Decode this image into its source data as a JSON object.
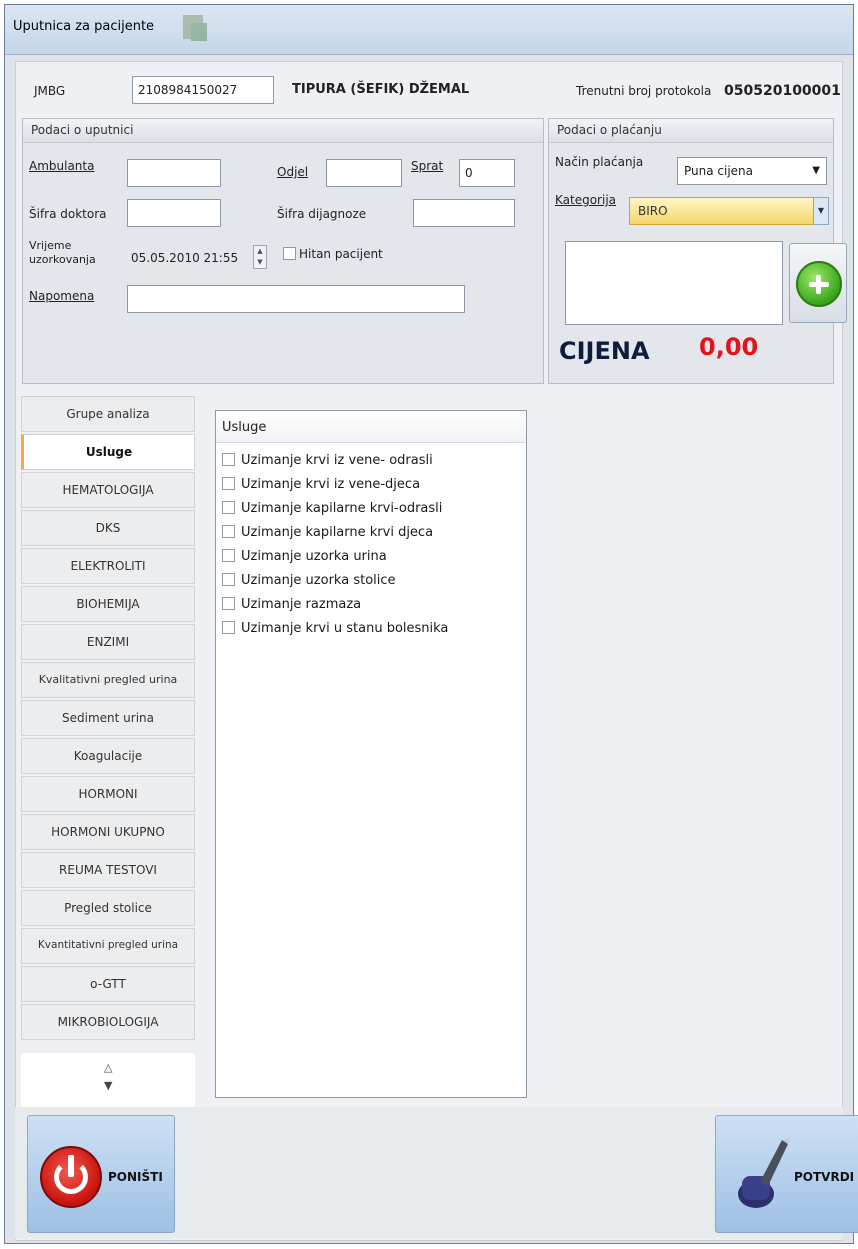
{
  "window": {
    "title": "Uputnica za pacijente"
  },
  "patient": {
    "jmbg_label": "JMBG",
    "jmbg_value": "2108984150027",
    "name": "TIPURA (ŠEFIK) DŽEMAL",
    "protocol_label": "Trenutni broj protokola",
    "protocol_value": "050520100001"
  },
  "referral": {
    "group_title": "Podaci o uputnici",
    "ambulanta_label": "Ambulanta",
    "ambulanta_value": "",
    "odjel_label": "Odjel",
    "odjel_value": "",
    "sprat_label": "Sprat",
    "sprat_value": "0",
    "sifra_doktora_label": "Šifra doktora",
    "sifra_doktora_value": "",
    "sifra_dijagnoze_label": "Šifra dijagnoze",
    "sifra_dijagnoze_value": "",
    "vrijeme_label_1": "Vrijeme",
    "vrijeme_label_2": "uzorkovanja",
    "vrijeme_value": "05.05.2010 21:55",
    "hitan_label": "Hitan pacijent",
    "napomena_label": "Napomena",
    "napomena_value": ""
  },
  "payment": {
    "group_title": "Podaci o plaćanju",
    "nacin_label": "Način plaćanja",
    "nacin_value": "Puna cijena",
    "kategorija_label": "Kategorija",
    "kategorija_value": "BIRO",
    "cijena_label": "CIJENA",
    "cijena_value": "0,00"
  },
  "tabs": [
    "Grupe analiza",
    "Usluge",
    "HEMATOLOGIJA",
    "DKS",
    "ELEKTROLITI",
    "BIOHEMIJA",
    "ENZIMI",
    "Kvalitativni pregled urina",
    "Sediment urina",
    "Koagulacije",
    "HORMONI",
    "HORMONI UKUPNO",
    "REUMA TESTOVI",
    "Pregled stolice",
    "Kvantitativni pregled urina",
    "o-GTT",
    "MIKROBIOLOGIJA"
  ],
  "services": {
    "header": "Usluge",
    "items": [
      "Uzimanje krvi iz vene- odrasli",
      "Uzimanje krvi iz vene-djeca",
      "Uzimanje kapilarne krvi-odrasli",
      "Uzimanje kapilarne krvi djeca",
      "Uzimanje uzorka urina",
      "Uzimanje uzorka stolice",
      "Uzimanje razmaza",
      "Uzimanje krvi u stanu bolesnika"
    ]
  },
  "footer": {
    "cancel_label": "PONIŠTI",
    "confirm_label": "POTVRDI"
  },
  "colors": {
    "price": "#e0141a",
    "accent_tab": "#f0a94b",
    "category_bg": "#f5d66a"
  }
}
